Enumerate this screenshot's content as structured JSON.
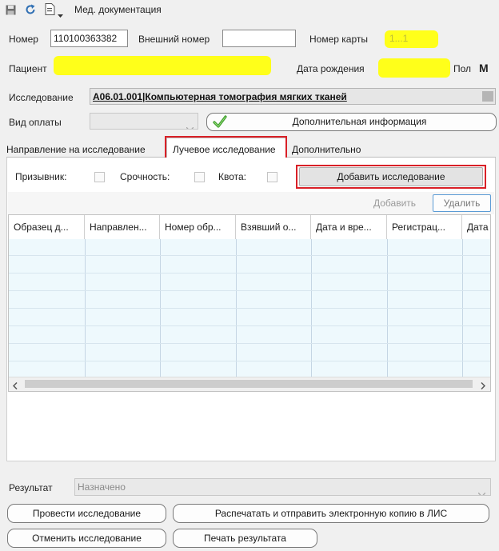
{
  "window": {
    "title": "Мед. документация"
  },
  "header": {
    "number_label": "Номер",
    "number_value": "110100363382",
    "external_label": "Внешний номер",
    "external_value": "",
    "card_label": "Номер карты",
    "card_value": "1...1",
    "patient_label": "Пациент",
    "birth_label": "Дата рождения",
    "gender_label": "Пол",
    "gender_value": "М"
  },
  "study": {
    "label": "Исследование",
    "value": "A06.01.001|Компьютерная томография мягких тканей"
  },
  "payment": {
    "label": "Вид оплаты",
    "value": "",
    "extra_info_button": "Дополнительная информация"
  },
  "tabs": [
    {
      "label": "Направление на исследование"
    },
    {
      "label": "Лучевое исследование"
    },
    {
      "label": "Дополнительно"
    }
  ],
  "options": {
    "conscript_label": "Призывник:",
    "urgency_label": "Срочность:",
    "quota_label": "Квота:",
    "add_study_button": "Добавить исследование"
  },
  "table": {
    "add_button": "Добавить",
    "delete_button": "Удалить",
    "columns": [
      "Образец д...",
      "Направлен...",
      "Номер обр...",
      "Взявший о...",
      "Дата и вре...",
      "Регистрац...",
      "Дата"
    ],
    "rows": []
  },
  "result": {
    "label": "Результат",
    "value": "Назначено"
  },
  "actions": {
    "conduct": "Провести исследование",
    "print_send": "Распечатать и отправить электронную копию в ЛИС",
    "cancel": "Отменить исследование",
    "print_result": "Печать результата"
  },
  "colors": {
    "highlight": "#ffff1a",
    "annotation_red": "#d92027",
    "grid_bg": "#eef9fd",
    "check_green": "#3b9b2a"
  },
  "icons": [
    "save-icon",
    "refresh-icon",
    "document-icon",
    "dropdown-arrow-icon",
    "green-check-icon",
    "scroll-left-icon",
    "scroll-right-icon",
    "combo-arrow-icon"
  ]
}
